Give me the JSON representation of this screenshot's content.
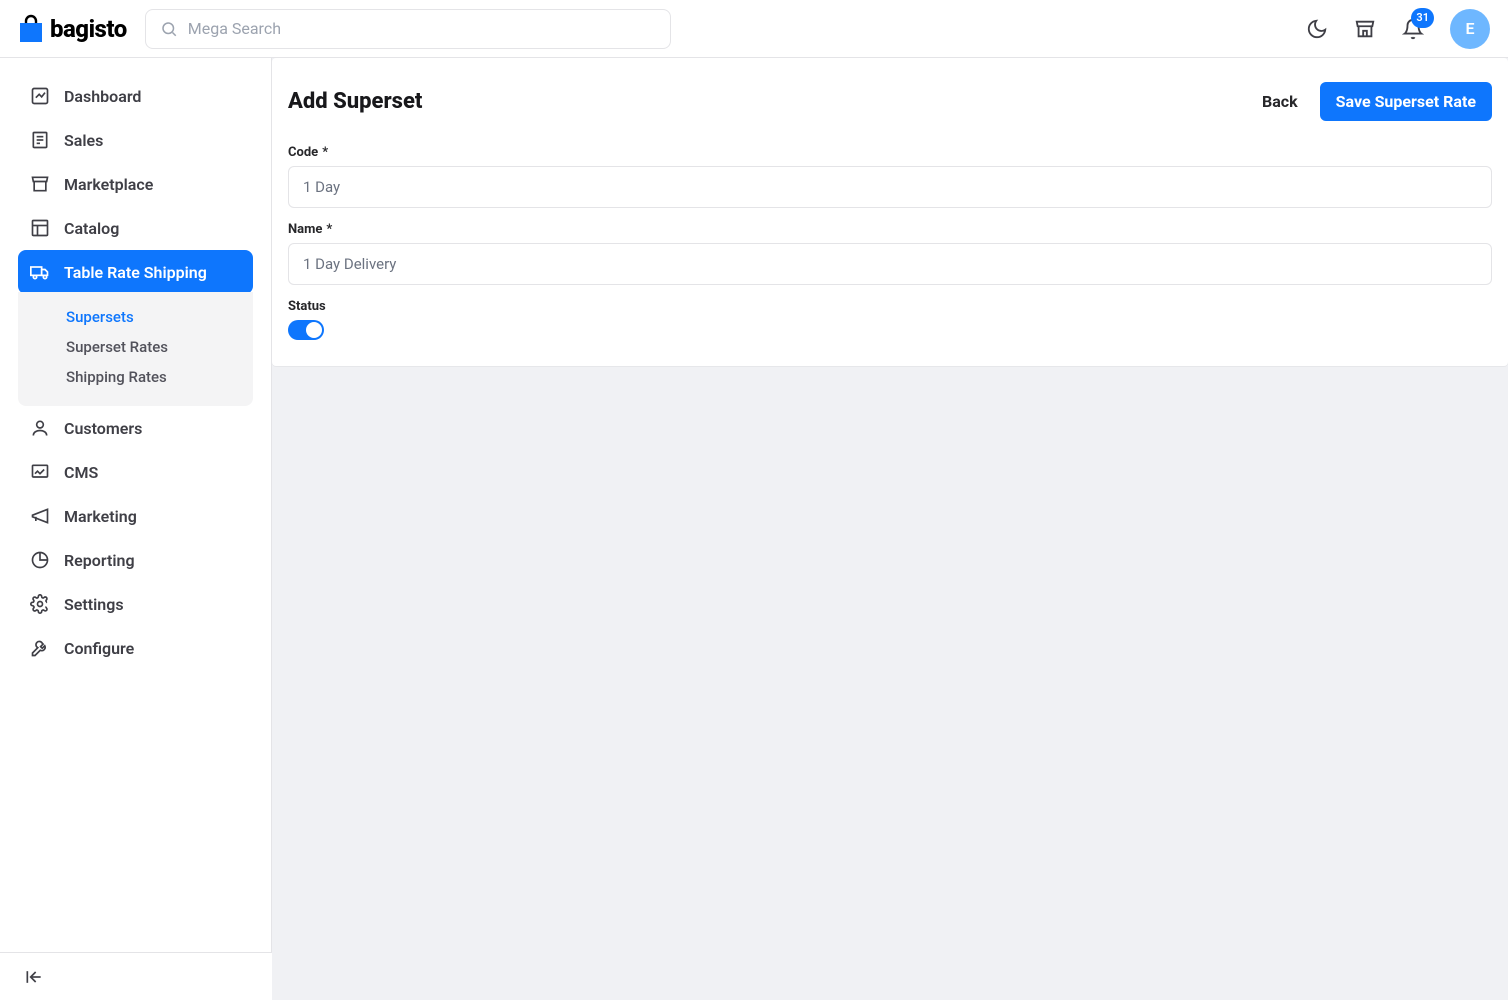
{
  "brand": {
    "name": "bagisto"
  },
  "search": {
    "placeholder": "Mega Search"
  },
  "notifications": {
    "count": "31"
  },
  "avatar": {
    "initial": "E"
  },
  "sidebar": {
    "items": [
      {
        "label": "Dashboard"
      },
      {
        "label": "Sales"
      },
      {
        "label": "Marketplace"
      },
      {
        "label": "Catalog"
      },
      {
        "label": "Table Rate Shipping"
      },
      {
        "label": "Customers"
      },
      {
        "label": "CMS"
      },
      {
        "label": "Marketing"
      },
      {
        "label": "Reporting"
      },
      {
        "label": "Settings"
      },
      {
        "label": "Configure"
      }
    ],
    "sub": {
      "supersets": "Supersets",
      "superset_rates": "Superset Rates",
      "shipping_rates": "Shipping Rates"
    }
  },
  "page": {
    "title": "Add Superset",
    "back": "Back",
    "save": "Save Superset Rate"
  },
  "form": {
    "code_label": "Code",
    "code_value": "1 Day",
    "name_label": "Name",
    "name_value": "1 Day Delivery",
    "status_label": "Status",
    "required": "*"
  }
}
